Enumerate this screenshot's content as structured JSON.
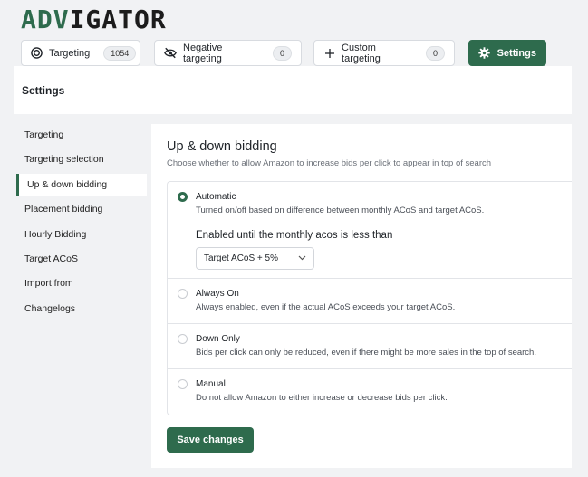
{
  "brand": {
    "logo_a": "ADV",
    "logo_b": "IGATOR",
    "color": "#2e6b4d"
  },
  "tabs": [
    {
      "label": "Targeting",
      "count": "1054",
      "icon": "target-icon"
    },
    {
      "label": "Negative targeting",
      "count": "0",
      "icon": "eye-off-icon"
    },
    {
      "label": "Custom targeting",
      "count": "0",
      "icon": "plus-icon"
    },
    {
      "label": "Settings",
      "icon": "gear-icon",
      "active": true
    }
  ],
  "header": {
    "title": "Settings"
  },
  "sidebar": {
    "items": [
      {
        "label": "Targeting"
      },
      {
        "label": "Targeting selection"
      },
      {
        "label": "Up & down bidding",
        "active": true
      },
      {
        "label": "Placement bidding"
      },
      {
        "label": "Hourly Bidding"
      },
      {
        "label": "Target ACoS"
      },
      {
        "label": "Import from"
      },
      {
        "label": "Changelogs"
      }
    ]
  },
  "main": {
    "title": "Up & down bidding",
    "description": "Choose whether to allow Amazon to increase bids per click to appear in top of search",
    "options": [
      {
        "label": "Automatic",
        "description": "Turned on/off based on difference between monthly ACoS and target ACoS.",
        "checked": true
      },
      {
        "label": "Always On",
        "description": "Always enabled, even if the actual ACoS exceeds your target ACoS.",
        "checked": false
      },
      {
        "label": "Down Only",
        "description": "Bids per click can only be reduced, even if there might be more sales in the top of search.",
        "checked": false
      },
      {
        "label": "Manual",
        "description": "Do not allow Amazon to either increase or decrease bids per click.",
        "checked": false
      }
    ],
    "threshold_label": "Enabled until the monthly acos is less than",
    "threshold_value": "Target ACoS + 5%",
    "save_label": "Save changes"
  }
}
